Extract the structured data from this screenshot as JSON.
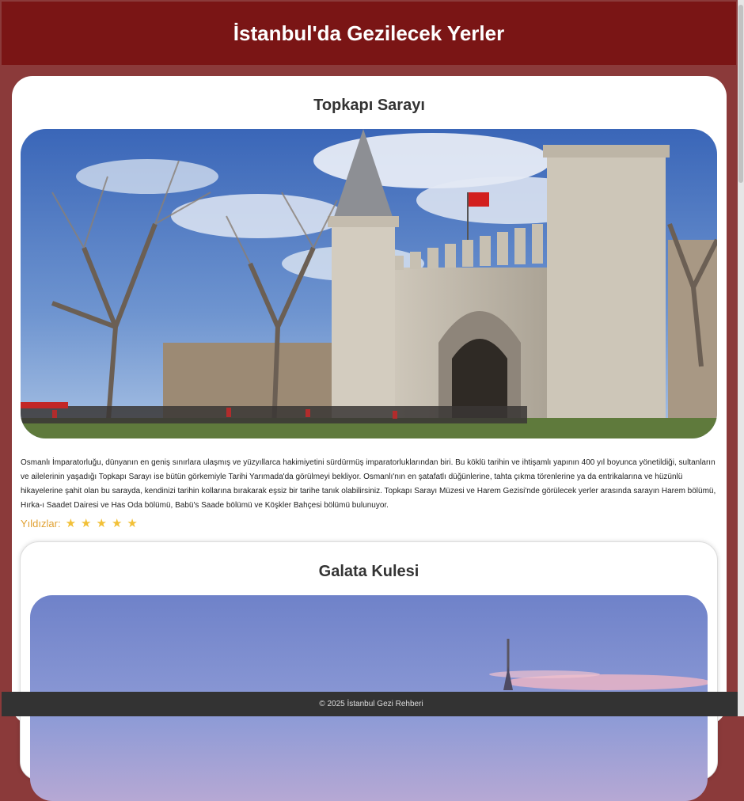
{
  "header": {
    "title": "İstanbul'da Gezilecek Yerler"
  },
  "places": [
    {
      "title": "Topkapı Sarayı",
      "description": "Osmanlı İmparatorluğu, dünyanın en geniş sınırlara ulaşmış ve yüzyıllarca hakimiyetini sürdürmüş imparatorluklarından biri. Bu köklü tarihin ve ihtişamlı yapının 400 yıl boyunca yönetildiği, sultanların ve ailelerinin yaşadığı Topkapı Sarayı ise bütün görkemiyle Tarihi Yarımada'da görülmeyi bekliyor. Osmanlı'nın en şatafatlı düğünlerine, tahta çıkma törenlerine ya da entrikalarına ve hüzünlü hikayelerine şahit olan bu sarayda, kendinizi tarihin kollarına bırakarak eşsiz bir tarihe tanık olabilirsiniz. Topkapı Sarayı Müzesi ve Harem Gezisi'nde görülecek yerler arasında sarayın Harem bölümü, Hırka-ı Saadet Dairesi ve Has Oda bölümü, Babü's Saade bölümü ve Köşkler Bahçesi bölümü bulunuyor.",
      "rating_label": "Yıldızlar:",
      "stars": 5,
      "star_glyph": "★"
    },
    {
      "title": "Galata Kulesi"
    }
  ],
  "footer": {
    "text": "© 2025 İstanbul Gezi Rehberi"
  },
  "colors": {
    "page_bg": "#8b3a3a",
    "header_bg": "#7a1515",
    "footer_bg": "#333333",
    "star": "#f2c037",
    "rating_label": "#e0a030"
  }
}
